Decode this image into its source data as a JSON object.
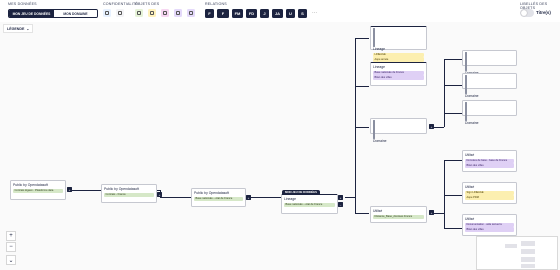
{
  "toolbar": {
    "data_title": "MES DONNÉES",
    "mine_label": "MON JEU DE DONNÉES",
    "domain_label": "MON DOMAINE",
    "confidentiality_title": "CONFIDENTIALITÉ",
    "objects_title": "OBJETS DES",
    "relations_title": "RELATIONS",
    "relations": [
      "F",
      "F",
      "FM",
      "FD",
      "J",
      "JA",
      "U",
      "S"
    ],
    "more": "···",
    "labels_title": "LIBELLÉS DES OBJETS",
    "labels_toggle": "Titre(s)"
  },
  "legend": {
    "label": "LÉGENDE",
    "chevron": "⌄"
  },
  "nodes": {
    "n1": {
      "title": "Public by Opendatasoft",
      "chip": "Contrats légaux - Plateforme data",
      "connector": "+"
    },
    "n2": {
      "title": "Public by Opendatasoft",
      "chip": "Contrats - France",
      "connector": "+"
    },
    "n3": {
      "title": "Public by Opendatasoft",
      "chip": "Base nationale – état de France",
      "connector": "+"
    },
    "n4": {
      "badge": "MON JEU DE DONNÉES",
      "title": "Lineage",
      "chip": "Base nationale – état de France",
      "connector": "+",
      "connector2": "−"
    },
    "n5": {
      "title": "Lineage",
      "chip_a": "LINEAGE",
      "chip_b": "Aspe année"
    },
    "n6": {
      "title": "Lineage",
      "chip_a": "Base nationale de France",
      "chip_b": "Bilan des villes"
    },
    "n7": {
      "title": "Domaine",
      "connector": "+"
    },
    "n8": {
      "title": "Utilisé",
      "chip": "Distance_Base_données France",
      "connector": "+"
    },
    "d1": {
      "title": "Domaine"
    },
    "d2": {
      "title": "Domaine"
    },
    "d3": {
      "title": "Domaine"
    },
    "u1": {
      "title": "Utilisé",
      "chip_a": "Données de base - base de France",
      "chip_b": "Bilan des villes"
    },
    "u2": {
      "title": "Utilisé",
      "chip_a": "Sign LINEAGE",
      "chip_b": "Aspe PDM"
    },
    "u3": {
      "title": "Utilisé",
      "chip_a": "Documentation - aide textuel à",
      "chip_b": "Bilan des villes"
    }
  },
  "zoom": {
    "in": "+",
    "out": "−",
    "fit": "⌄"
  },
  "colors": {
    "navy": "#1c2340",
    "green": "#d6e8c8",
    "yellow": "#fcefb0",
    "purple": "#dfd0f5"
  }
}
